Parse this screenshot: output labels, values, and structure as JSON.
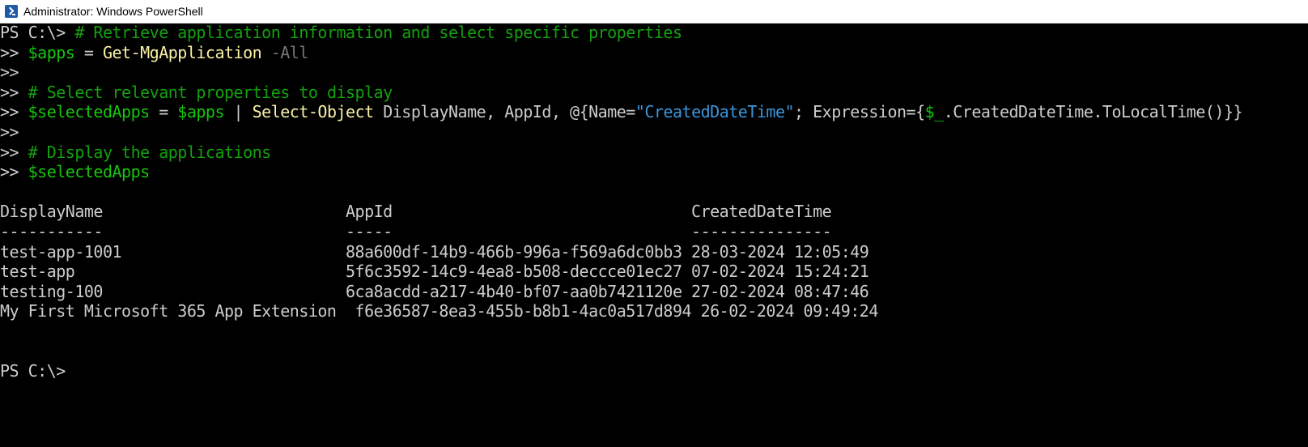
{
  "window": {
    "title": "Administrator: Windows PowerShell"
  },
  "terminal": {
    "lines": [
      [
        {
          "t": "PS C:\\> ",
          "c": "w"
        },
        {
          "t": "# Retrieve application information and select specific properties",
          "c": "g"
        }
      ],
      [
        {
          "t": ">> ",
          "c": "w"
        },
        {
          "t": "$apps",
          "c": "c"
        },
        {
          "t": " = ",
          "c": "w"
        },
        {
          "t": "Get-MgApplication",
          "c": "y"
        },
        {
          "t": " -All",
          "c": "gr"
        }
      ],
      [
        {
          "t": ">>",
          "c": "w"
        }
      ],
      [
        {
          "t": ">> ",
          "c": "w"
        },
        {
          "t": "# Select relevant properties to display",
          "c": "g"
        }
      ],
      [
        {
          "t": ">> ",
          "c": "w"
        },
        {
          "t": "$selectedApps",
          "c": "c"
        },
        {
          "t": " = ",
          "c": "w"
        },
        {
          "t": "$apps",
          "c": "c"
        },
        {
          "t": " | ",
          "c": "w"
        },
        {
          "t": "Select-Object",
          "c": "y"
        },
        {
          "t": " DisplayName, AppId, @{Name=",
          "c": "w"
        },
        {
          "t": "\"CreatedDateTime\"",
          "c": "t"
        },
        {
          "t": "; Expression={",
          "c": "w"
        },
        {
          "t": "$_",
          "c": "c"
        },
        {
          "t": ".CreatedDateTime.ToLocalTime()}}",
          "c": "w"
        }
      ],
      [
        {
          "t": ">>",
          "c": "w"
        }
      ],
      [
        {
          "t": ">> ",
          "c": "w"
        },
        {
          "t": "# Display the applications",
          "c": "g"
        }
      ],
      [
        {
          "t": ">> ",
          "c": "w"
        },
        {
          "t": "$selectedApps",
          "c": "c"
        }
      ],
      [],
      [
        {
          "t": "DisplayName                          AppId                                CreatedDateTime",
          "c": "w"
        }
      ],
      [
        {
          "t": "-----------                          -----                                ---------------",
          "c": "w"
        }
      ],
      [
        {
          "t": "test-app-1001                        88a600df-14b9-466b-996a-f569a6dc0bb3 28-03-2024 12:05:49",
          "c": "w"
        }
      ],
      [
        {
          "t": "test-app                             5f6c3592-14c9-4ea8-b508-deccce01ec27 07-02-2024 15:24:21",
          "c": "w"
        }
      ],
      [
        {
          "t": "testing-100                          6ca8acdd-a217-4b40-bf07-aa0b7421120e 27-02-2024 08:47:46",
          "c": "w"
        }
      ],
      [
        {
          "t": "My First Microsoft 365 App Extension  f6e36587-8ea3-455b-b8b1-4ac0a517d894 26-02-2024 09:49:24",
          "c": "w"
        }
      ],
      [],
      [],
      [
        {
          "t": "PS C:\\>",
          "c": "w"
        }
      ]
    ]
  }
}
